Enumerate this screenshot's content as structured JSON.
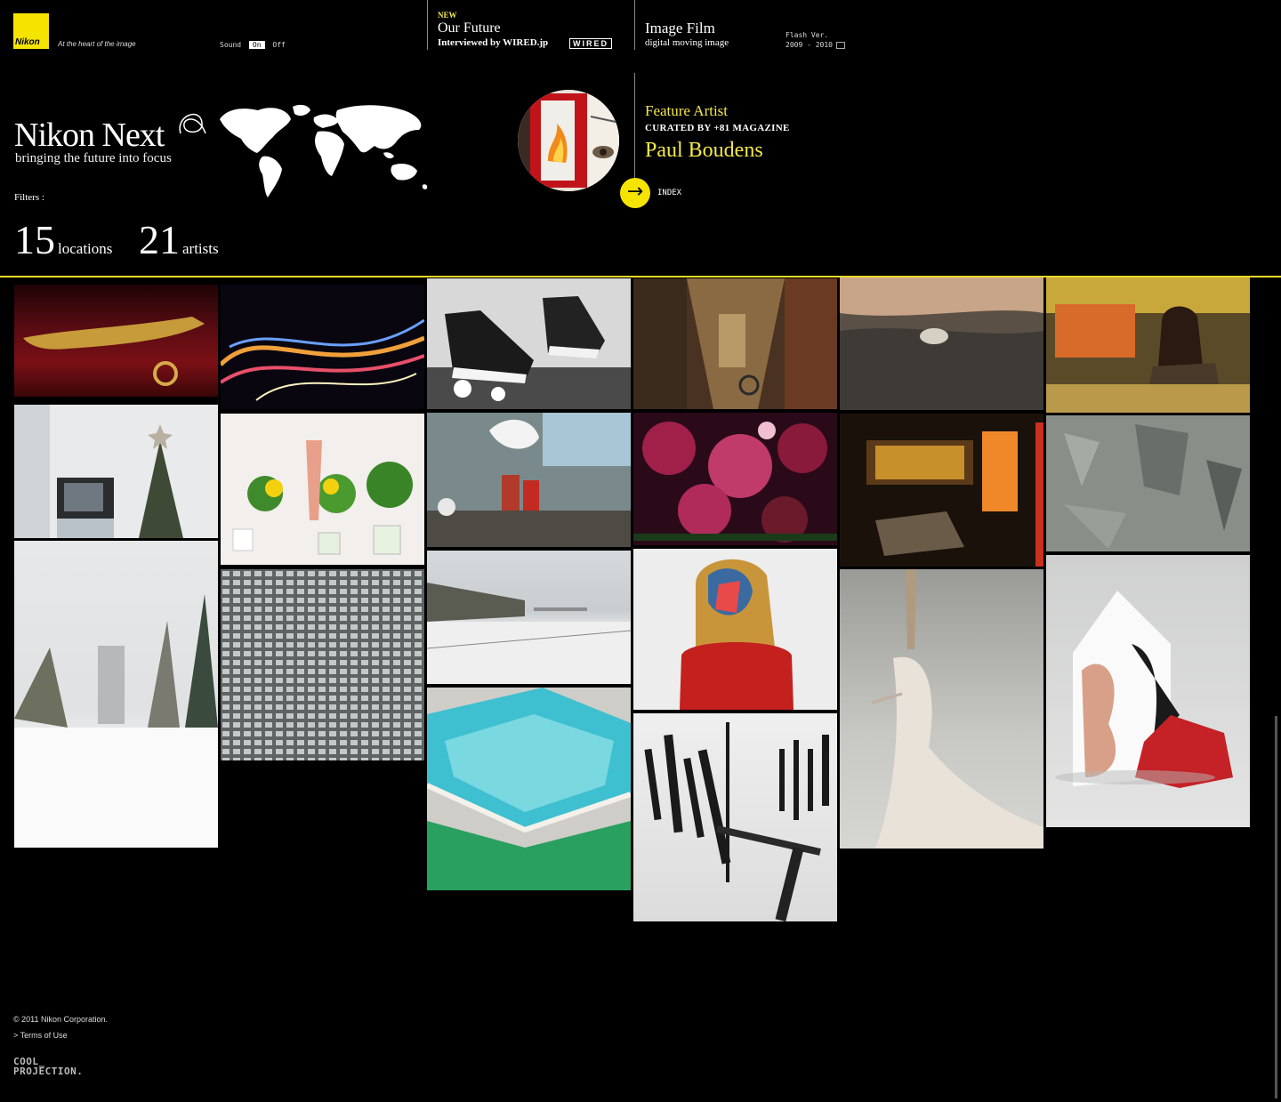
{
  "brand": {
    "logo_text": "Nikon",
    "tagline": "At the heart of the image",
    "title": "Nikon Next",
    "subtitle": "bringing the future into focus"
  },
  "sound": {
    "label": "Sound",
    "on": "On",
    "off": "Off"
  },
  "nav": {
    "new_label": "NEW",
    "our_future": "Our Future",
    "interviewed": "Interviewed by WIRED.jp",
    "wired_logo": "WIRED",
    "image_film": "Image Film",
    "digital": "digital moving image",
    "flash_ver": "Flash Ver.",
    "flash_years": "2009 - 2010"
  },
  "filters": {
    "label": "Filters :",
    "locations_count": "15",
    "locations_label": "locations",
    "artists_count": "21",
    "artists_label": "artists"
  },
  "feature": {
    "label": "Feature Artist",
    "curated": "CURATED BY +81 MAGAZINE",
    "artist": "Paul Boudens",
    "index": "INDEX"
  },
  "footer": {
    "copyright": "© 2011 Nikon Corporation.",
    "terms": "> Terms of Use",
    "cool": "COOL_",
    "projection": "PROJECTION."
  },
  "colors": {
    "accent": "#f5e400",
    "rule": "#e7d92a",
    "text_accent": "#f5e94a"
  },
  "icons": {
    "arrow": "arrow-right-icon",
    "world": "world-map-icon",
    "window": "window-icon"
  }
}
